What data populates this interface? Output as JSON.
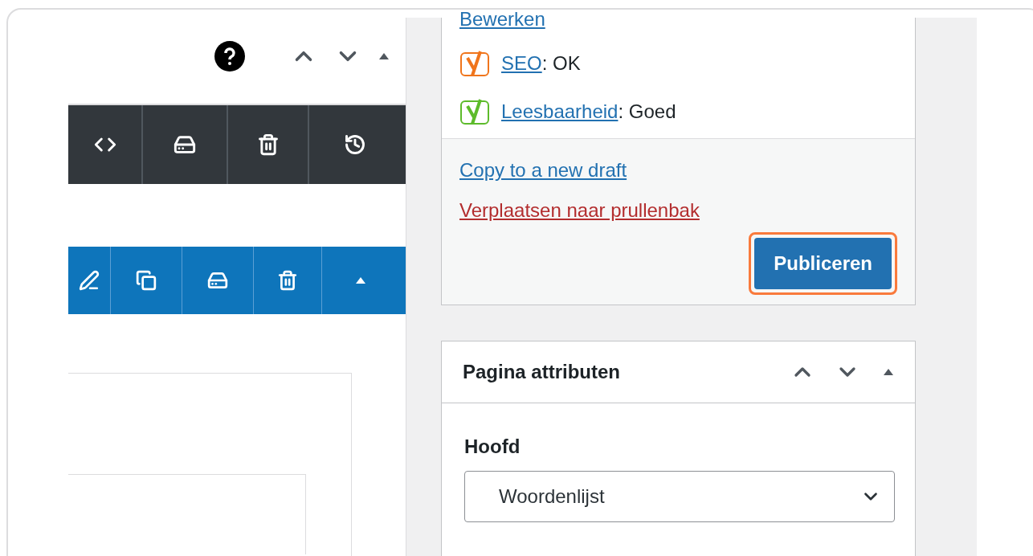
{
  "publish_box": {
    "edit_link": "Bewerken",
    "scores": [
      {
        "label": "SEO",
        "value": ": OK",
        "color": "#f0751c"
      },
      {
        "label": "Leesbaarheid",
        "value": ": Goed",
        "color": "#5dbb2b"
      }
    ],
    "copy_link": "Copy to a new draft",
    "trash_link": "Verplaatsen naar prullenbak",
    "publish_button": {
      "label": "Publiceren",
      "highlighted": true
    }
  },
  "page_attributes": {
    "title": "Pagina attributen",
    "parent_label": "Hoofd",
    "parent_value": "Woordenlijst"
  }
}
